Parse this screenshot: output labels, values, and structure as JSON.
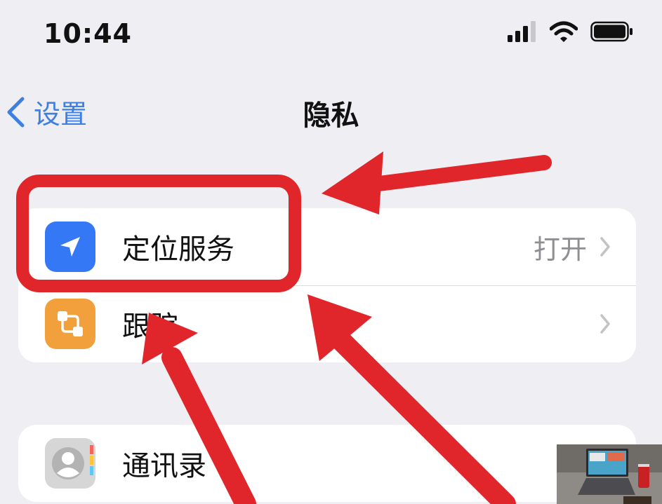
{
  "status_bar": {
    "time": "10:44"
  },
  "nav": {
    "back_label": "设置",
    "title": "隐私"
  },
  "groups": [
    {
      "rows": [
        {
          "label": "定位服务",
          "value": "打开",
          "icon": "location-arrow-icon",
          "icon_color": "#3478f6"
        },
        {
          "label": "跟踪",
          "value": "",
          "icon": "tracking-icon",
          "icon_color": "#f1a03b"
        }
      ]
    },
    {
      "rows": [
        {
          "label": "通讯录",
          "value": "",
          "icon": "contacts-icon",
          "icon_color": "#d8d8d8"
        }
      ]
    }
  ],
  "annotation_color": "#e0262b"
}
